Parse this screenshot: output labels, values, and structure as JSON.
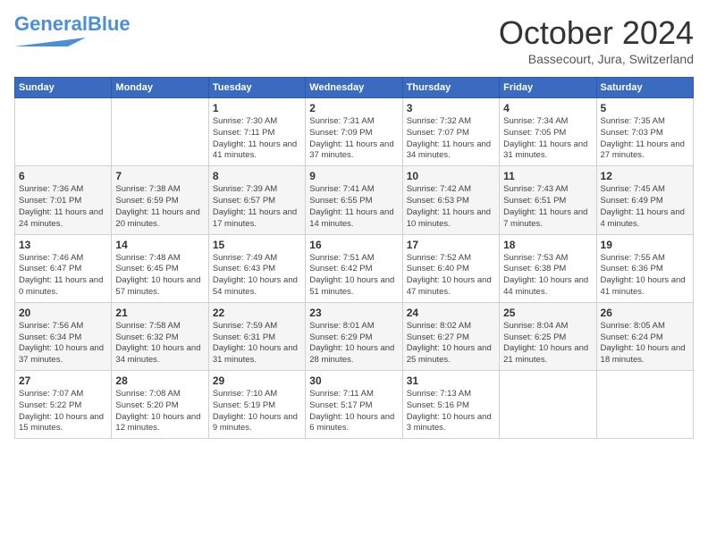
{
  "logo": {
    "line1": "General",
    "line2": "Blue"
  },
  "title": "October 2024",
  "location": "Bassecourt, Jura, Switzerland",
  "days_of_week": [
    "Sunday",
    "Monday",
    "Tuesday",
    "Wednesday",
    "Thursday",
    "Friday",
    "Saturday"
  ],
  "weeks": [
    [
      {
        "day": "",
        "info": ""
      },
      {
        "day": "",
        "info": ""
      },
      {
        "day": "1",
        "info": "Sunrise: 7:30 AM\nSunset: 7:11 PM\nDaylight: 11 hours and 41 minutes."
      },
      {
        "day": "2",
        "info": "Sunrise: 7:31 AM\nSunset: 7:09 PM\nDaylight: 11 hours and 37 minutes."
      },
      {
        "day": "3",
        "info": "Sunrise: 7:32 AM\nSunset: 7:07 PM\nDaylight: 11 hours and 34 minutes."
      },
      {
        "day": "4",
        "info": "Sunrise: 7:34 AM\nSunset: 7:05 PM\nDaylight: 11 hours and 31 minutes."
      },
      {
        "day": "5",
        "info": "Sunrise: 7:35 AM\nSunset: 7:03 PM\nDaylight: 11 hours and 27 minutes."
      }
    ],
    [
      {
        "day": "6",
        "info": "Sunrise: 7:36 AM\nSunset: 7:01 PM\nDaylight: 11 hours and 24 minutes."
      },
      {
        "day": "7",
        "info": "Sunrise: 7:38 AM\nSunset: 6:59 PM\nDaylight: 11 hours and 20 minutes."
      },
      {
        "day": "8",
        "info": "Sunrise: 7:39 AM\nSunset: 6:57 PM\nDaylight: 11 hours and 17 minutes."
      },
      {
        "day": "9",
        "info": "Sunrise: 7:41 AM\nSunset: 6:55 PM\nDaylight: 11 hours and 14 minutes."
      },
      {
        "day": "10",
        "info": "Sunrise: 7:42 AM\nSunset: 6:53 PM\nDaylight: 11 hours and 10 minutes."
      },
      {
        "day": "11",
        "info": "Sunrise: 7:43 AM\nSunset: 6:51 PM\nDaylight: 11 hours and 7 minutes."
      },
      {
        "day": "12",
        "info": "Sunrise: 7:45 AM\nSunset: 6:49 PM\nDaylight: 11 hours and 4 minutes."
      }
    ],
    [
      {
        "day": "13",
        "info": "Sunrise: 7:46 AM\nSunset: 6:47 PM\nDaylight: 11 hours and 0 minutes."
      },
      {
        "day": "14",
        "info": "Sunrise: 7:48 AM\nSunset: 6:45 PM\nDaylight: 10 hours and 57 minutes."
      },
      {
        "day": "15",
        "info": "Sunrise: 7:49 AM\nSunset: 6:43 PM\nDaylight: 10 hours and 54 minutes."
      },
      {
        "day": "16",
        "info": "Sunrise: 7:51 AM\nSunset: 6:42 PM\nDaylight: 10 hours and 51 minutes."
      },
      {
        "day": "17",
        "info": "Sunrise: 7:52 AM\nSunset: 6:40 PM\nDaylight: 10 hours and 47 minutes."
      },
      {
        "day": "18",
        "info": "Sunrise: 7:53 AM\nSunset: 6:38 PM\nDaylight: 10 hours and 44 minutes."
      },
      {
        "day": "19",
        "info": "Sunrise: 7:55 AM\nSunset: 6:36 PM\nDaylight: 10 hours and 41 minutes."
      }
    ],
    [
      {
        "day": "20",
        "info": "Sunrise: 7:56 AM\nSunset: 6:34 PM\nDaylight: 10 hours and 37 minutes."
      },
      {
        "day": "21",
        "info": "Sunrise: 7:58 AM\nSunset: 6:32 PM\nDaylight: 10 hours and 34 minutes."
      },
      {
        "day": "22",
        "info": "Sunrise: 7:59 AM\nSunset: 6:31 PM\nDaylight: 10 hours and 31 minutes."
      },
      {
        "day": "23",
        "info": "Sunrise: 8:01 AM\nSunset: 6:29 PM\nDaylight: 10 hours and 28 minutes."
      },
      {
        "day": "24",
        "info": "Sunrise: 8:02 AM\nSunset: 6:27 PM\nDaylight: 10 hours and 25 minutes."
      },
      {
        "day": "25",
        "info": "Sunrise: 8:04 AM\nSunset: 6:25 PM\nDaylight: 10 hours and 21 minutes."
      },
      {
        "day": "26",
        "info": "Sunrise: 8:05 AM\nSunset: 6:24 PM\nDaylight: 10 hours and 18 minutes."
      }
    ],
    [
      {
        "day": "27",
        "info": "Sunrise: 7:07 AM\nSunset: 5:22 PM\nDaylight: 10 hours and 15 minutes."
      },
      {
        "day": "28",
        "info": "Sunrise: 7:08 AM\nSunset: 5:20 PM\nDaylight: 10 hours and 12 minutes."
      },
      {
        "day": "29",
        "info": "Sunrise: 7:10 AM\nSunset: 5:19 PM\nDaylight: 10 hours and 9 minutes."
      },
      {
        "day": "30",
        "info": "Sunrise: 7:11 AM\nSunset: 5:17 PM\nDaylight: 10 hours and 6 minutes."
      },
      {
        "day": "31",
        "info": "Sunrise: 7:13 AM\nSunset: 5:16 PM\nDaylight: 10 hours and 3 minutes."
      },
      {
        "day": "",
        "info": ""
      },
      {
        "day": "",
        "info": ""
      }
    ]
  ]
}
